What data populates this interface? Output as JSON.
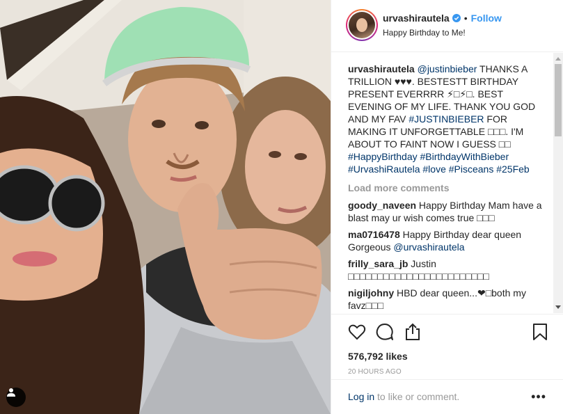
{
  "header": {
    "username": "urvashirautela",
    "follow_label": "Follow",
    "location": "Happy Birthday to Me!",
    "dot": "•"
  },
  "caption": {
    "username": "urvashirautela",
    "mention": "@justinbieber",
    "text1": " THANKS A TRILLION ♥♥♥. BESTESTT BIRTHDAY PRESENT EVERRRR ⚡︎□⚡︎□. BEST EVENING OF MY LIFE. THANK YOU GOD AND MY FAV ",
    "tag1": "#JUSTINBIEBER",
    "text2": " FOR MAKING IT UNFORGETTABLE □□□. I'M ABOUT TO FAINT NOW I GUESS □□ ",
    "tag2": "#HappyBirthday",
    "tag3": "#BirthdayWithBieber",
    "tag4": "#UrvashiRautela",
    "tag5": "#love",
    "tag6": "#Pisceans",
    "tag7": "#25Feb"
  },
  "load_more": "Load more comments",
  "comments": [
    {
      "user": "goody_naveen",
      "text": " Happy Birthday Mam have a blast may ur wish comes true □□□"
    },
    {
      "user": "ma0716478",
      "text": " Happy Birthday dear queen Gorgeous ",
      "mention": "@urvashirautela"
    },
    {
      "user": "frilly_sara_jb",
      "text": " Justin □□□□□□□□□□□□□□□□□□□□□□□□"
    },
    {
      "user": "nigiljohny",
      "text": " HBD dear queen...❤□both my favz□□□"
    }
  ],
  "likes": "576,792 likes",
  "time": "20 HOURS AGO",
  "footer": {
    "login": "Log in",
    "rest": " to like or comment.",
    "more": "•••"
  },
  "icons": {
    "like": "heart-icon",
    "comment": "comment-icon",
    "share": "share-icon",
    "save": "bookmark-icon",
    "user_tags": "user-icon"
  },
  "colors": {
    "accent": "#3897f0",
    "link": "#003569",
    "muted": "#999999"
  }
}
